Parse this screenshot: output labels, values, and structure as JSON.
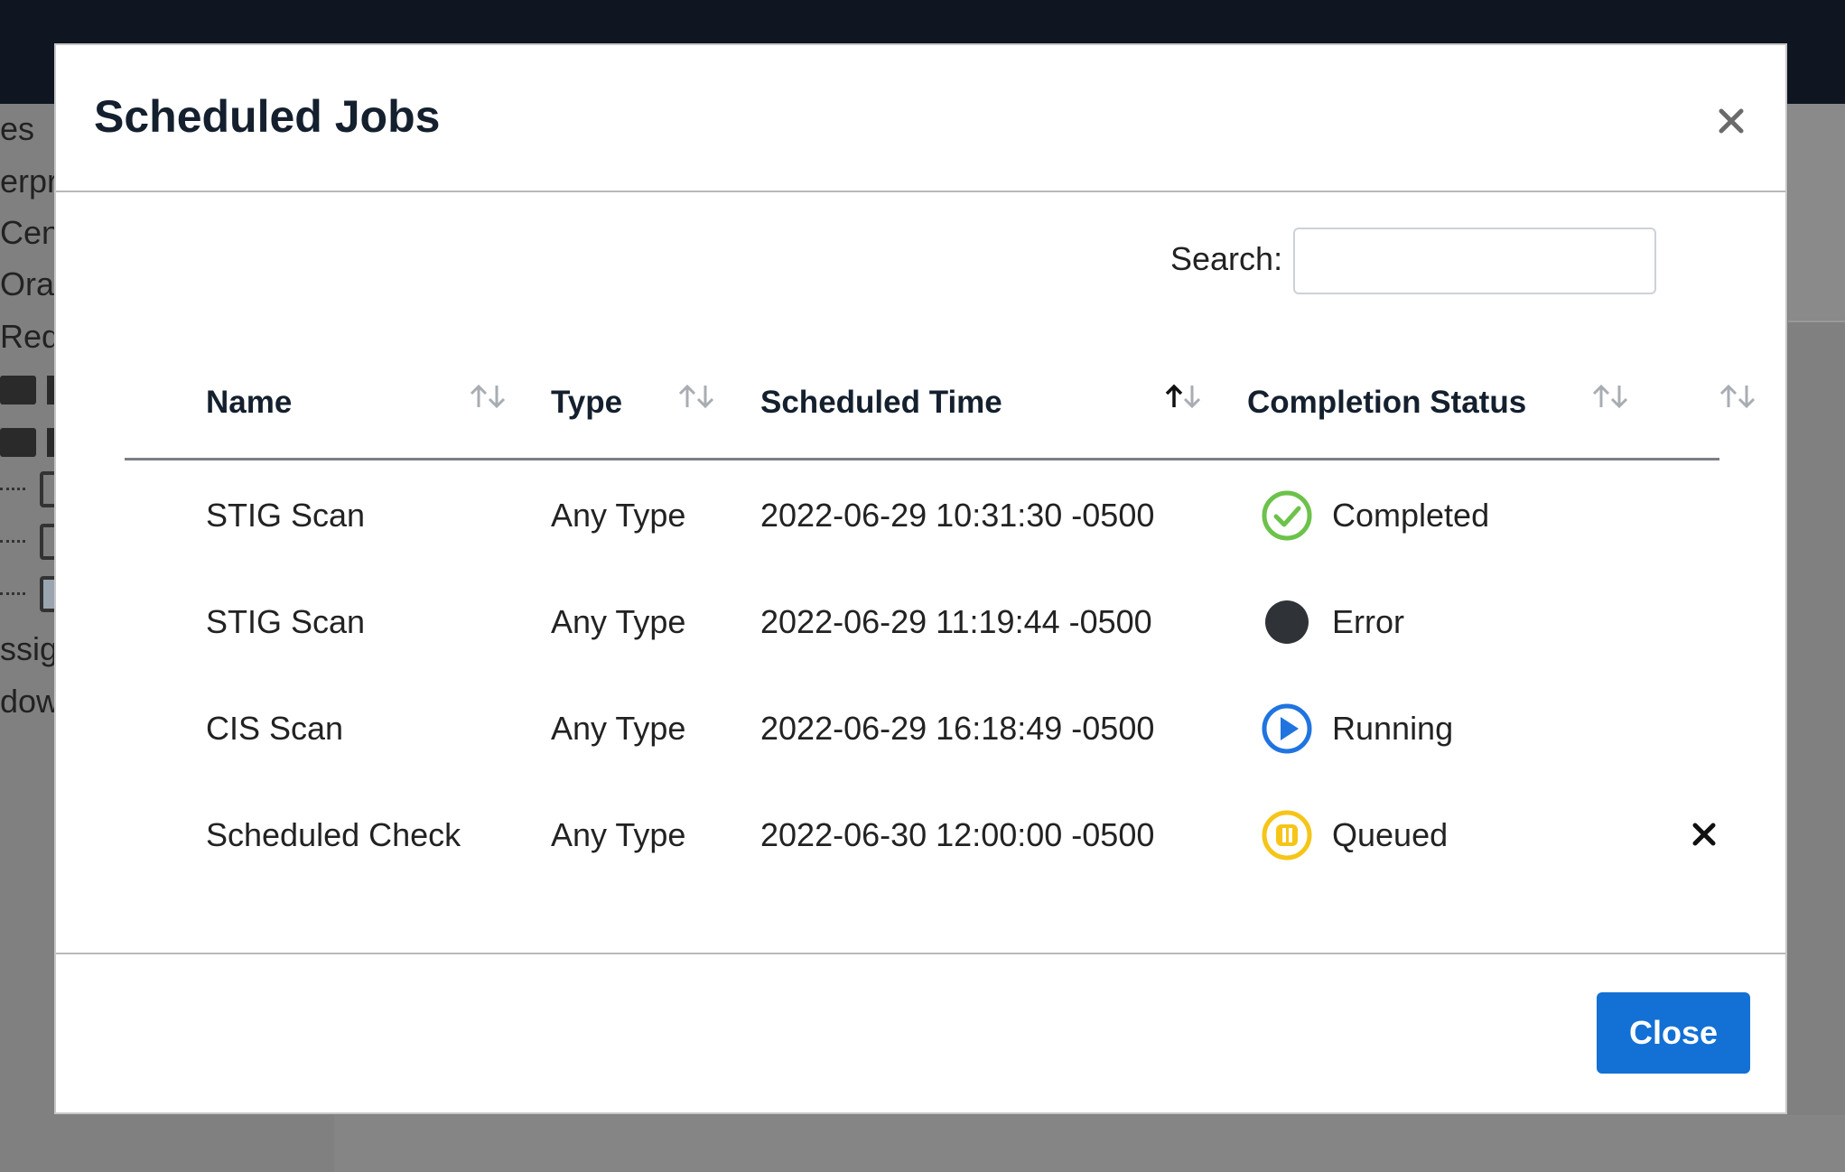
{
  "background": {
    "sidebar_items": [
      "es",
      "erpr",
      "Cent",
      "Orac",
      "Red",
      "ssig",
      "dow"
    ]
  },
  "modal": {
    "title": "Scheduled Jobs",
    "search": {
      "label": "Search:",
      "value": "",
      "placeholder": ""
    },
    "columns": [
      {
        "label": "Name",
        "sort": "none"
      },
      {
        "label": "Type",
        "sort": "none"
      },
      {
        "label": "Scheduled Time",
        "sort": "ascending"
      },
      {
        "label": "Completion Status",
        "sort": "none"
      },
      {
        "label": "",
        "sort": "none"
      }
    ],
    "rows": [
      {
        "name": "STIG Scan",
        "type": "Any Type",
        "scheduled_time": "2022-06-29 10:31:30 -0500",
        "status": "Completed",
        "status_icon": "check-circle-icon",
        "removable": false
      },
      {
        "name": "STIG Scan",
        "type": "Any Type",
        "scheduled_time": "2022-06-29 11:19:44 -0500",
        "status": "Error",
        "status_icon": "filled-circle-icon",
        "removable": false
      },
      {
        "name": "CIS Scan",
        "type": "Any Type",
        "scheduled_time": "2022-06-29 16:18:49 -0500",
        "status": "Running",
        "status_icon": "play-circle-icon",
        "removable": false
      },
      {
        "name": "Scheduled Check",
        "type": "Any Type",
        "scheduled_time": "2022-06-30 12:00:00 -0500",
        "status": "Queued",
        "status_icon": "pause-circle-icon",
        "removable": true
      }
    ],
    "close_button": "Close"
  },
  "colors": {
    "completed": "#6cc24a",
    "error": "#2f3338",
    "running": "#1f74e0",
    "queued": "#f5c518",
    "primary_button": "#1370d4",
    "topbar": "#0f1622"
  }
}
